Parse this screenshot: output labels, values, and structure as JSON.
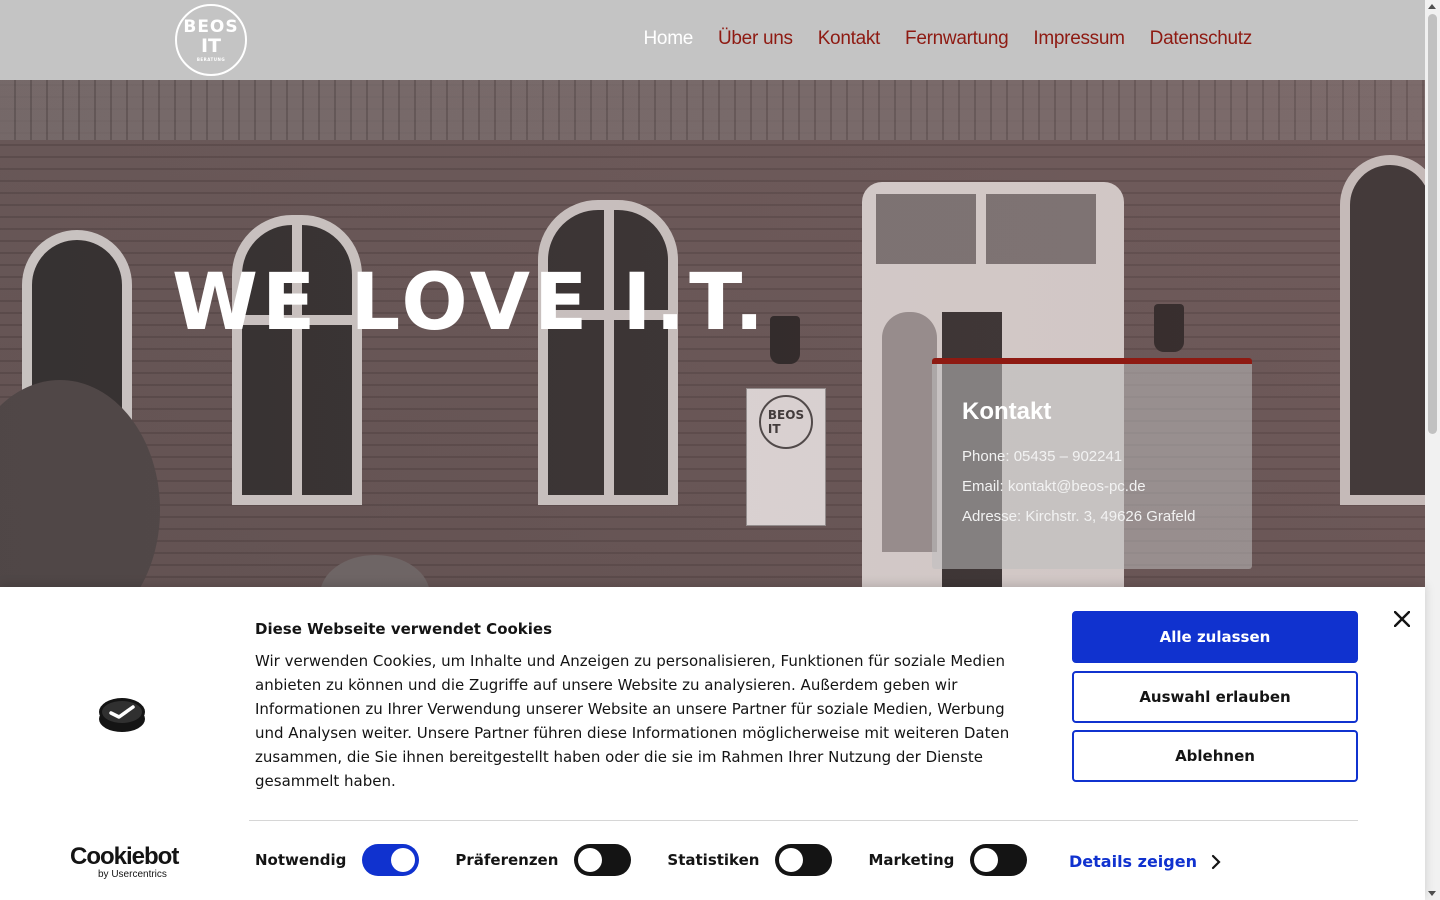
{
  "site": {
    "logo_line1": "BEOS",
    "logo_line2": "IT",
    "logo_line3": "BERATUNG"
  },
  "nav": [
    {
      "label": "Home",
      "active": true
    },
    {
      "label": "Über uns",
      "active": false
    },
    {
      "label": "Kontakt",
      "active": false
    },
    {
      "label": "Fernwartung",
      "active": false
    },
    {
      "label": "Impressum",
      "active": false
    },
    {
      "label": "Datenschutz",
      "active": false
    }
  ],
  "hero": {
    "title": "WE LOVE I.T."
  },
  "contact": {
    "title": "Kontakt",
    "phone": "Phone: 05435 – 902241",
    "email": "Email: kontakt@beos-pc.de",
    "address": "Adresse: Kirchstr. 3, 49626 Grafeld"
  },
  "cookie": {
    "title": "Diese Webseite verwendet Cookies",
    "text": "Wir verwenden Cookies, um Inhalte und Anzeigen zu personalisieren, Funktionen für soziale Medien anbieten zu können und die Zugriffe auf unsere Website zu analysieren. Außerdem geben wir Informationen zu Ihrer Verwendung unserer Website an unsere Partner für soziale Medien, Werbung und Analysen weiter. Unsere Partner führen diese Informationen möglicherweise mit weiteren Daten zusammen, die Sie ihnen bereitgestellt haben oder die sie im Rahmen Ihrer Nutzung der Dienste gesammelt haben.",
    "allow_all": "Alle zulassen",
    "allow_selection": "Auswahl erlauben",
    "decline": "Ablehnen",
    "toggles": [
      {
        "label": "Notwendig",
        "on": true
      },
      {
        "label": "Präferenzen",
        "on": false
      },
      {
        "label": "Statistiken",
        "on": false
      },
      {
        "label": "Marketing",
        "on": false
      }
    ],
    "details_link": "Details zeigen",
    "brand_name": "Cookiebot",
    "brand_sub": "by Usercentrics"
  },
  "colors": {
    "nav_link": "#8e1a12",
    "accent_blue": "#1032cf",
    "header_bg": "#c4c4c4"
  }
}
